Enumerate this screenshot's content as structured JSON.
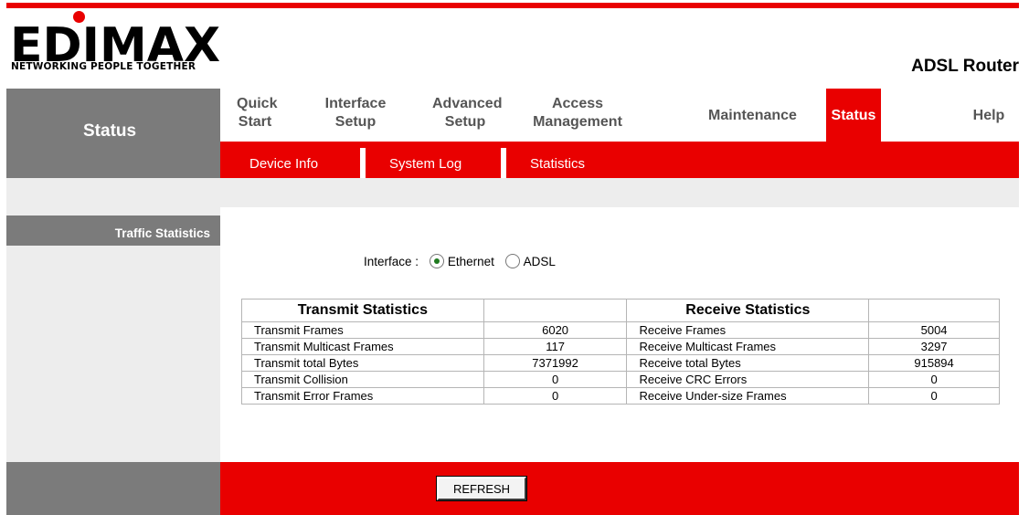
{
  "brand": {
    "logo_text": "EDIMAX",
    "tagline": "NETWORKING PEOPLE TOGETHER",
    "product": "ADSL Router"
  },
  "nav": {
    "section_title": "Status",
    "items": [
      {
        "label_line1": "Quick",
        "label_line2": "Start"
      },
      {
        "label_line1": "Interface",
        "label_line2": "Setup"
      },
      {
        "label_line1": "Advanced",
        "label_line2": "Setup"
      },
      {
        "label_line1": "Access",
        "label_line2": "Management"
      },
      {
        "label_line1": "Maintenance",
        "label_line2": ""
      },
      {
        "label_line1": "Status",
        "label_line2": ""
      },
      {
        "label_line1": "Help",
        "label_line2": ""
      }
    ],
    "active": "Status",
    "sub_items": [
      "Device Info",
      "System Log",
      "Statistics"
    ]
  },
  "section": {
    "title": "Traffic Statistics"
  },
  "interface": {
    "label": "Interface :",
    "options": [
      "Ethernet",
      "ADSL"
    ],
    "selected": "Ethernet"
  },
  "table": {
    "transmit_header": "Transmit Statistics",
    "receive_header": "Receive Statistics",
    "rows": [
      {
        "tx_label": "Transmit Frames",
        "tx_value": "6020",
        "rx_label": "Receive Frames",
        "rx_value": "5004"
      },
      {
        "tx_label": "Transmit Multicast Frames",
        "tx_value": "117",
        "rx_label": "Receive Multicast Frames",
        "rx_value": "3297"
      },
      {
        "tx_label": "Transmit total Bytes",
        "tx_value": "7371992",
        "rx_label": "Receive total Bytes",
        "rx_value": "915894"
      },
      {
        "tx_label": "Transmit Collision",
        "tx_value": "0",
        "rx_label": "Receive CRC Errors",
        "rx_value": "0"
      },
      {
        "tx_label": "Transmit Error Frames",
        "tx_value": "0",
        "rx_label": "Receive Under-size Frames",
        "rx_value": "0"
      }
    ]
  },
  "buttons": {
    "refresh": "REFRESH"
  },
  "colors": {
    "accent": "#e90000",
    "gray": "#7b7b7b",
    "panel": "#ededed"
  }
}
